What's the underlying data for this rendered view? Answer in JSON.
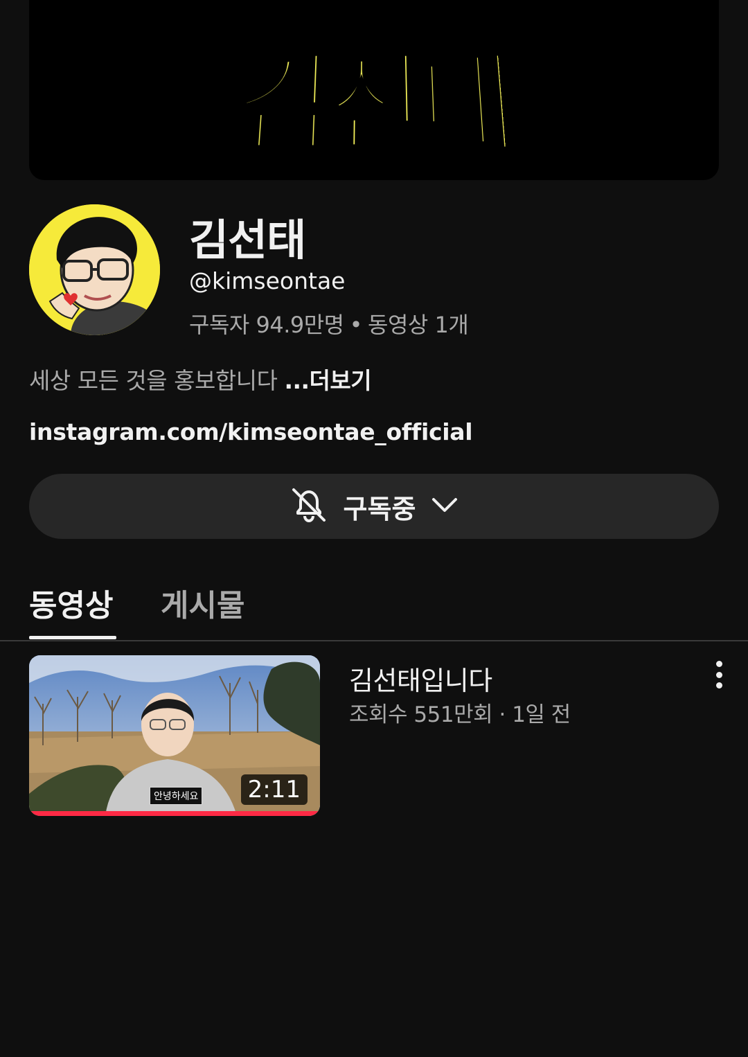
{
  "banner": {
    "logo_text": "김선태"
  },
  "channel": {
    "name": "김선태",
    "handle": "@kimseontae",
    "subscribers": "구독자 94.9만명",
    "stats_separator": "•",
    "videos_count": "동영상 1개",
    "description": "세상 모든 것을 홍보합니다",
    "more_label": "...더보기",
    "link": "instagram.com/kimseontae_official",
    "avatar_icon": "avatar-caricature"
  },
  "subscribe": {
    "label": "구독중",
    "bell_icon": "bell-off-icon",
    "chevron_icon": "chevron-down-icon"
  },
  "tabs": [
    {
      "label": "동영상",
      "selected": true
    },
    {
      "label": "게시물",
      "selected": false
    }
  ],
  "videos": [
    {
      "title": "김선태입니다",
      "views": "조회수 551만회",
      "meta_separator": "·",
      "age": "1일 전",
      "duration": "2:11",
      "thumbnail_caption": "안녕하세요",
      "watch_progress": 1.0
    }
  ],
  "colors": {
    "background": "#0f0f0f",
    "button_bg": "#272727",
    "banner_logo": "#f5f25a",
    "avatar_bg": "#f6ea3a",
    "progress": "#ff2a45"
  }
}
